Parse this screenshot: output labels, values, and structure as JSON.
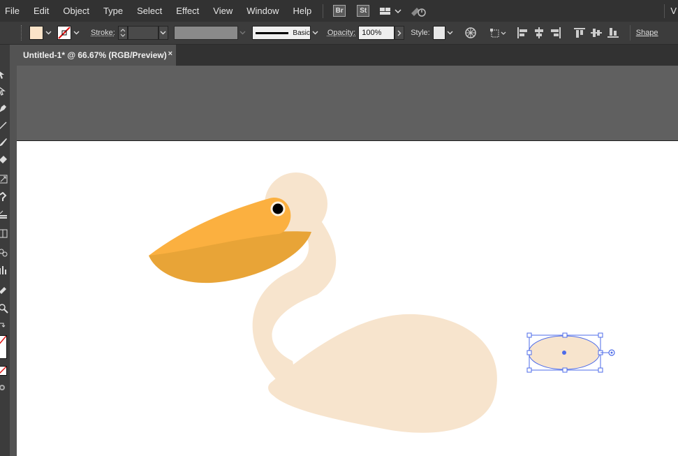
{
  "menubar": {
    "items": [
      "File",
      "Edit",
      "Object",
      "Type",
      "Select",
      "Effect",
      "View",
      "Window",
      "Help"
    ],
    "bridge_badge": "Br",
    "stock_badge": "St",
    "right_text": "V"
  },
  "controlbar": {
    "fill_color": "#FBE3C8",
    "stroke_label": "Stroke:",
    "stroke_weight": "",
    "brush_label": "Basic",
    "opacity_label": "Opacity:",
    "opacity_value": "100%",
    "style_label": "Style:",
    "shape_label": "Shape"
  },
  "document": {
    "tab_title": "Untitled-1* @ 66.67% (RGB/Preview)",
    "close_glyph": "×"
  },
  "colors": {
    "pelican_body": "#F7E4CD",
    "beak_top": "#FBB040",
    "beak_bottom": "#E8A437",
    "selection": "#4D6BE9"
  }
}
